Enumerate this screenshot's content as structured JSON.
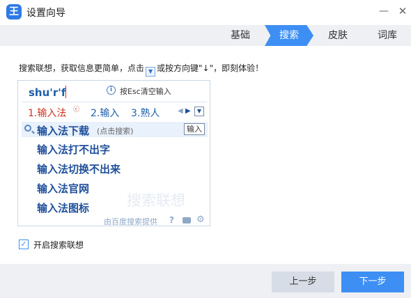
{
  "window": {
    "app_icon_text": "王",
    "title": "设置向导",
    "minimize_glyph": "—",
    "close_glyph": "✕"
  },
  "tabs": [
    {
      "label": "基础"
    },
    {
      "label": "搜索",
      "active": true
    },
    {
      "label": "皮肤"
    },
    {
      "label": "词库"
    }
  ],
  "instruction": {
    "part1": "搜索联想，获取信息更简单，点击",
    "part2": "或按方向键\"↓\"，即刻体验！"
  },
  "ime": {
    "pinyin": "shu'r'f",
    "esc_hint": "按Esc清空输入",
    "candidates": [
      "1.输入法",
      "2.输入",
      "3.熟人"
    ],
    "suggest_main": "输入法下载",
    "suggest_tip": "(点击搜索)",
    "input_button": "输入",
    "suggestions": [
      "输入法打不出字",
      "输入法切换不出来",
      "输入法官网",
      "输入法图标"
    ],
    "watermark": "搜索联想",
    "footer_text": "由百度搜索提供"
  },
  "options": {
    "enable_search_suggest": {
      "label": "开启搜索联想",
      "checked": true
    }
  },
  "buttons": {
    "prev": "上一步",
    "next": "下一步"
  },
  "colors": {
    "accent": "#3d8ff4",
    "candidate_selected": "#d0311f",
    "text_link": "#1f4f9a"
  }
}
